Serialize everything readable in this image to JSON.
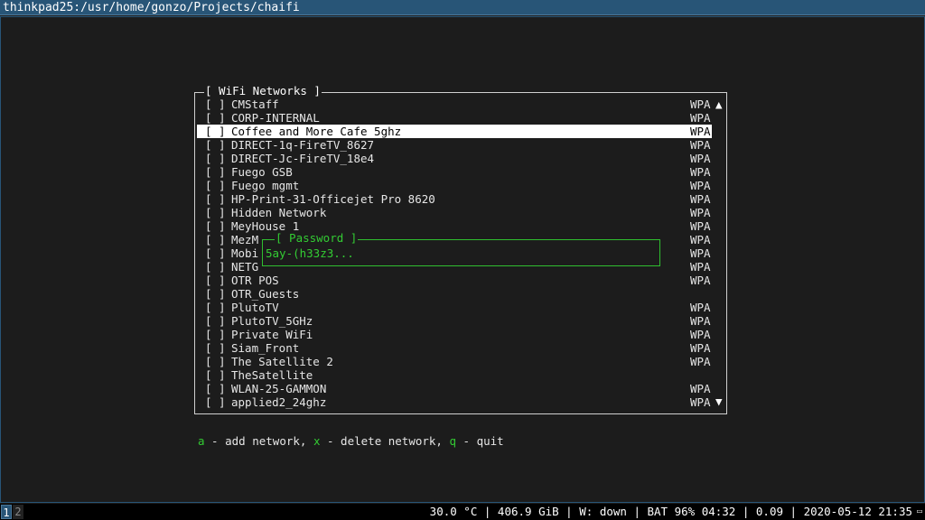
{
  "window": {
    "title": "thinkpad25:/usr/home/gonzo/Projects/chaifi"
  },
  "wifi": {
    "title": "[ WiFi Networks ]",
    "scroll_up": "▲",
    "scroll_down": "▼",
    "networks": [
      {
        "check": "[ ]",
        "ssid": "CMStaff",
        "security": "WPA"
      },
      {
        "check": "[ ]",
        "ssid": "CORP-INTERNAL",
        "security": "WPA"
      },
      {
        "check": "[ ]",
        "ssid": "Coffee and More Cafe 5ghz",
        "security": "WPA",
        "selected": true
      },
      {
        "check": "[ ]",
        "ssid": "DIRECT-1q-FireTV_8627",
        "security": "WPA"
      },
      {
        "check": "[ ]",
        "ssid": "DIRECT-Jc-FireTV_18e4",
        "security": "WPA"
      },
      {
        "check": "[ ]",
        "ssid": "Fuego GSB",
        "security": "WPA"
      },
      {
        "check": "[ ]",
        "ssid": "Fuego mgmt",
        "security": "WPA"
      },
      {
        "check": "[ ]",
        "ssid": "HP-Print-31-Officejet Pro 8620",
        "security": "WPA"
      },
      {
        "check": "[ ]",
        "ssid": "Hidden Network",
        "security": "WPA"
      },
      {
        "check": "[ ]",
        "ssid": "MeyHouse 1",
        "security": "WPA"
      },
      {
        "check": "[ ]",
        "ssid": "MezM",
        "security": "WPA"
      },
      {
        "check": "[ ]",
        "ssid": "Mobi",
        "security": "WPA"
      },
      {
        "check": "[ ]",
        "ssid": "NETG",
        "security": "WPA"
      },
      {
        "check": "[ ]",
        "ssid": "OTR POS",
        "security": "WPA"
      },
      {
        "check": "[ ]",
        "ssid": "OTR_Guests",
        "security": ""
      },
      {
        "check": "[ ]",
        "ssid": "PlutoTV",
        "security": "WPA"
      },
      {
        "check": "[ ]",
        "ssid": "PlutoTV_5GHz",
        "security": "WPA"
      },
      {
        "check": "[ ]",
        "ssid": "Private WiFi",
        "security": "WPA"
      },
      {
        "check": "[ ]",
        "ssid": "Siam_Front",
        "security": "WPA"
      },
      {
        "check": "[ ]",
        "ssid": "The Satellite 2",
        "security": "WPA"
      },
      {
        "check": "[ ]",
        "ssid": "TheSatellite",
        "security": ""
      },
      {
        "check": "[ ]",
        "ssid": "WLAN-25-GAMMON",
        "security": "WPA"
      },
      {
        "check": "[ ]",
        "ssid": "applied2_24ghz",
        "security": "WPA"
      }
    ]
  },
  "password": {
    "title": "[ Password ]",
    "value": "5ay-(h33z3..."
  },
  "hints": {
    "add_key": "a",
    "add_text": " - add network, ",
    "delete_key": "x",
    "delete_text": " - delete network, ",
    "quit_key": "q",
    "quit_text": " - quit"
  },
  "statusbar": {
    "workspaces": [
      "1",
      "2"
    ],
    "text": "30.0 °C | 406.9 GiB | W: down | BAT 96% 04:32 | 0.09 | 2020-05-12 21:35",
    "tray": "▭"
  },
  "colors": {
    "accent": "#33cc33",
    "titlebar": "#285577",
    "background": "#1c1c1c"
  }
}
